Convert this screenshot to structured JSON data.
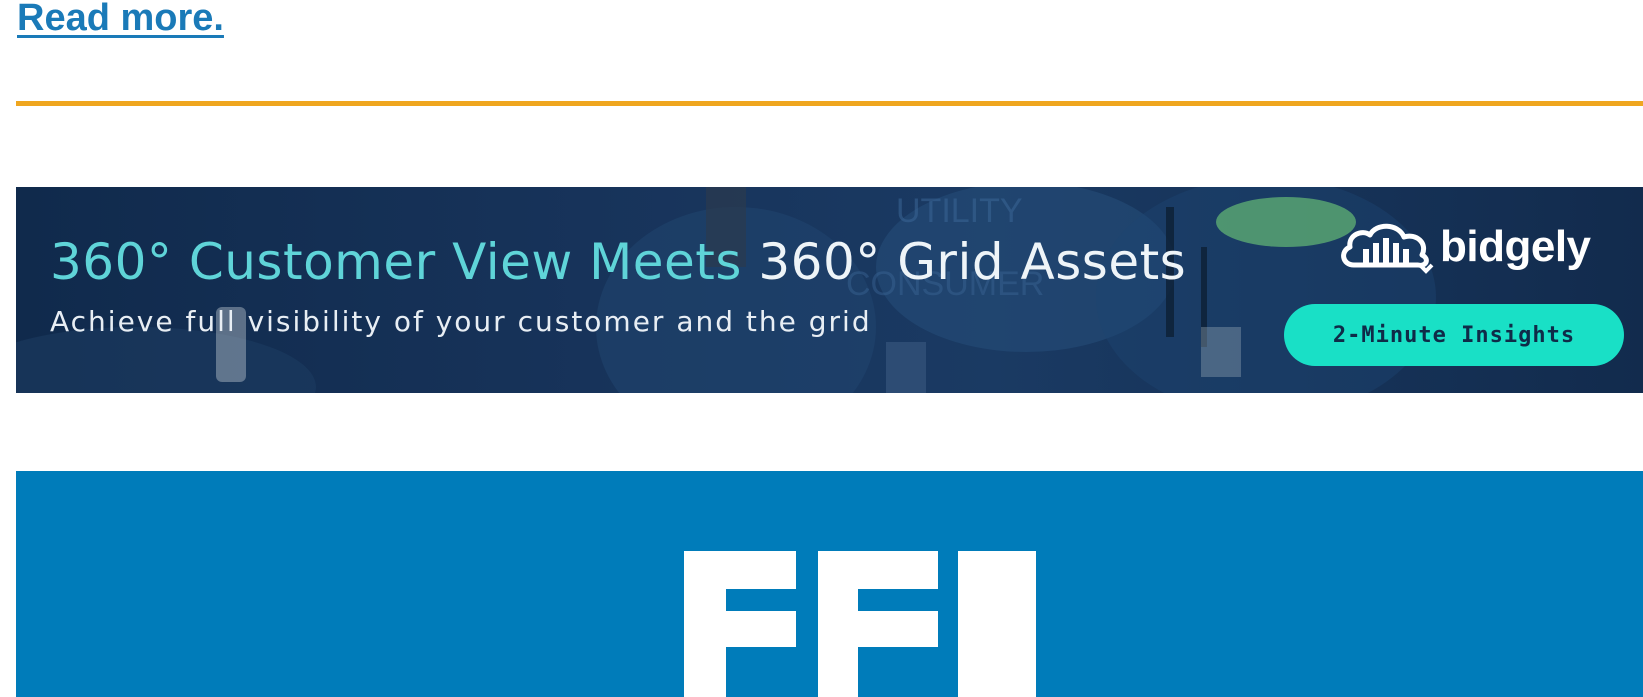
{
  "link": {
    "read_more": "Read more."
  },
  "colors": {
    "link": "#1a7ab8",
    "divider": "#efa61f",
    "banner_bg": "#17335a",
    "banner_accent": "#5fd4d8",
    "cta_bg": "#19e0c6",
    "eei_blue": "#007cba"
  },
  "banner": {
    "headline_part1": "360° Customer View Meets ",
    "headline_part2": "360° Grid Assets",
    "subheadline": "Achieve full visibility of your customer and the grid",
    "brand_name": "bidgely",
    "cta_label": "2-Minute Insights",
    "bg_words": [
      "UTILITY",
      "CONSUMER"
    ],
    "brand_icon": "cloud-bars-icon"
  },
  "footer": {
    "logo_text": "EEI",
    "logo_icon": "eei-logo"
  }
}
